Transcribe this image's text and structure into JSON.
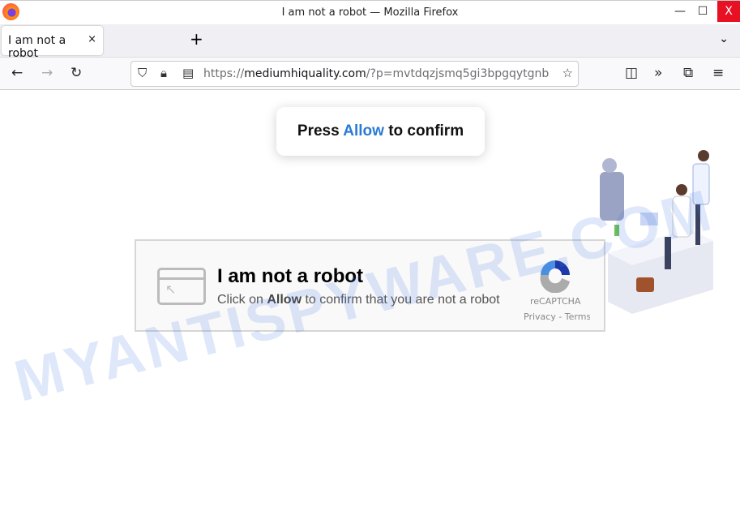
{
  "window": {
    "title": "I am not a robot — Mozilla Firefox",
    "minimize": "—",
    "maximize": "☐",
    "close": "X"
  },
  "tab": {
    "label": "I am not a robot",
    "close": "×",
    "new_tab": "+",
    "list_all": "⌄"
  },
  "nav": {
    "back": "←",
    "forward": "→",
    "reload": "↻",
    "url_prefix": "https://",
    "url_domain": "mediumhiquality.com",
    "url_rest": "/?p=mvtdqzjsmq5gi3bpgqytgnb",
    "pocket": "◫",
    "overflow": "»",
    "extensions": "⧉",
    "menu": "≡",
    "bookmark": "☆"
  },
  "popup": {
    "before": "Press ",
    "allow": "Allow",
    "after": " to confirm"
  },
  "captcha": {
    "title": "I am not a robot",
    "sub_before": "Click on ",
    "sub_allow": "Allow",
    "sub_after": " to confirm that you are not a robot",
    "brand": "reCAPTCHA",
    "links": "Privacy - Terms"
  },
  "watermark": "MYANTISPYWARE.COM",
  "colors": {
    "accent": "#2a7ad5",
    "close_button": "#e81123"
  }
}
